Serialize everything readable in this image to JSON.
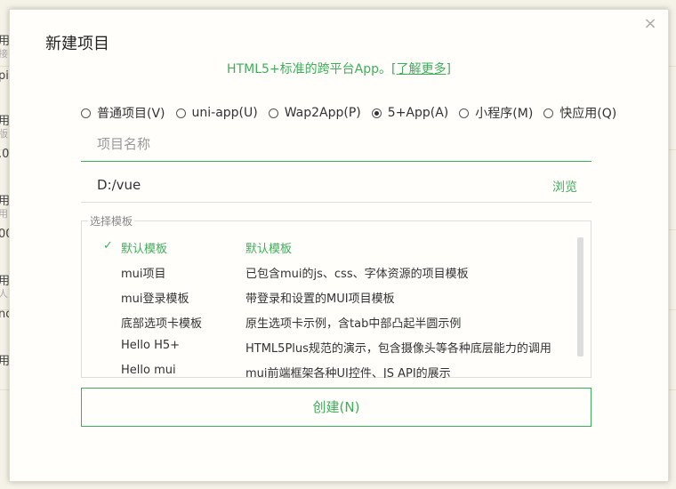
{
  "background": {
    "rows": [
      {
        "text": "用",
        "sub": "接",
        "value": "pi"
      },
      {
        "text": "用",
        "sub": "版",
        "value": ".0"
      },
      {
        "text": "用",
        "sub": "用",
        "value": "00"
      },
      {
        "text": "用",
        "sub": "人",
        "value": "nd"
      },
      {
        "text": "用",
        "sub": "",
        "value": ""
      }
    ]
  },
  "dialog": {
    "title": "新建项目",
    "close_icon": "×",
    "subtitle_prefix": "HTML5+标准的跨平台App。",
    "subtitle_link": "[了解更多]",
    "project_types": [
      {
        "label": "普通项目(V)",
        "selected": false
      },
      {
        "label": "uni-app(U)",
        "selected": false
      },
      {
        "label": "Wap2App(P)",
        "selected": false
      },
      {
        "label": "5+App(A)",
        "selected": true
      },
      {
        "label": "小程序(M)",
        "selected": false
      },
      {
        "label": "快应用(Q)",
        "selected": false
      }
    ],
    "name_field": {
      "value": "",
      "placeholder": "项目名称"
    },
    "path_field": {
      "value": "D:/vue",
      "placeholder": ""
    },
    "browse_label": "浏览",
    "template_legend": "选择模板",
    "templates": [
      {
        "name": "默认模板",
        "desc": "默认模板",
        "selected": true
      },
      {
        "name": "mui项目",
        "desc": "已包含mui的js、css、字体资源的项目模板",
        "selected": false
      },
      {
        "name": "mui登录模板",
        "desc": "带登录和设置的MUI项目模板",
        "selected": false
      },
      {
        "name": "底部选项卡模板",
        "desc": "原生选项卡示例，含tab中部凸起半圆示例",
        "selected": false
      },
      {
        "name": "Hello H5+",
        "desc": "HTML5Plus规范的演示，包含摄像头等各种底层能力的调用",
        "selected": false
      },
      {
        "name": "Hello mui",
        "desc": "mui前端框架各种UI控件、JS API的展示",
        "selected": false
      }
    ],
    "check_icon": "✓",
    "create_label": "创建(N)"
  }
}
